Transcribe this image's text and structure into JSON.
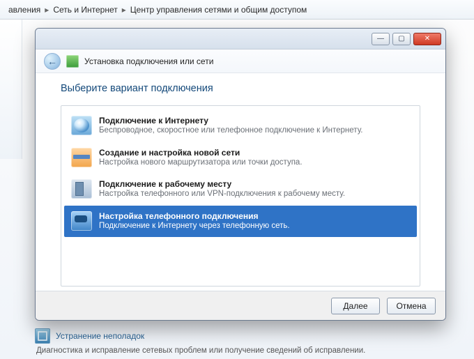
{
  "breadcrumb": {
    "items": [
      "авления",
      "Сеть и Интернет",
      "Центр управления сетями и общим доступом"
    ],
    "sep": "▸"
  },
  "background": {
    "troubleshoot_link": "Устранение неполадок",
    "troubleshoot_desc": "Диагностика и исправление сетевых проблем или получение сведений об исправлении."
  },
  "wizard": {
    "window_controls": {
      "min": "—",
      "max": "▢",
      "close": "✕"
    },
    "back_glyph": "←",
    "subtitle": "Установка подключения или сети",
    "heading": "Выберите вариант подключения",
    "options": [
      {
        "selected": false,
        "icon": "globe",
        "title": "Подключение к Интернету",
        "sub": "Беспроводное, скоростное или телефонное подключение к Интернету."
      },
      {
        "selected": false,
        "icon": "router",
        "title": "Создание и настройка новой сети",
        "sub": "Настройка нового маршрутизатора или точки доступа."
      },
      {
        "selected": false,
        "icon": "building",
        "title": "Подключение к рабочему месту",
        "sub": "Настройка телефонного или VPN-подключения к рабочему месту."
      },
      {
        "selected": true,
        "icon": "phone",
        "title": "Настройка телефонного подключения",
        "sub": "Подключение к Интернету через телефонную сеть."
      }
    ],
    "buttons": {
      "next": "Далее",
      "cancel": "Отмена"
    }
  }
}
